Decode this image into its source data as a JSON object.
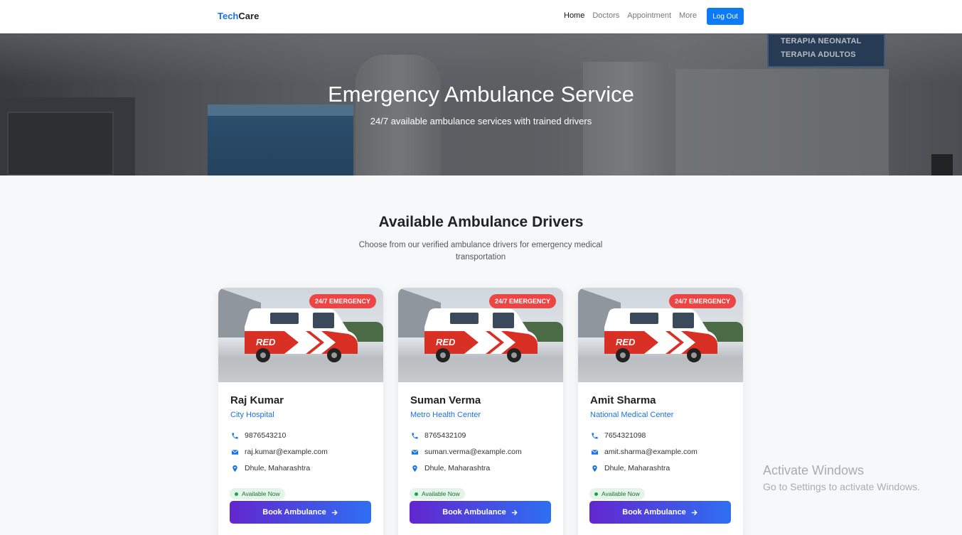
{
  "navbar": {
    "brand_part1": "Tech",
    "brand_part2": "Care",
    "links": [
      {
        "label": "Home",
        "active": true
      },
      {
        "label": "Doctors",
        "active": false
      },
      {
        "label": "Appointment",
        "active": false
      },
      {
        "label": "More",
        "active": false
      }
    ],
    "logout_label": "Log Out"
  },
  "hero": {
    "title": "Emergency Ambulance Service",
    "subtitle": "24/7 available ambulance services with trained drivers",
    "sign_lines": [
      "TERAPIA NEONATAL",
      "TERAPIA ADULTOS"
    ]
  },
  "section": {
    "title": "Available Ambulance Drivers",
    "subtitle": "Choose from our verified ambulance drivers for emergency medical transportation"
  },
  "drivers": [
    {
      "badge": "24/7 EMERGENCY",
      "name": "Raj Kumar",
      "hospital": "City Hospital",
      "phone": "9876543210",
      "email": "raj.kumar@example.com",
      "location": "Dhule, Maharashtra",
      "status": "Available Now",
      "button": "Book Ambulance"
    },
    {
      "badge": "24/7 EMERGENCY",
      "name": "Suman Verma",
      "hospital": "Metro Health Center",
      "phone": "8765432109",
      "email": "suman.verma@example.com",
      "location": "Dhule, Maharashtra",
      "status": "Available Now",
      "button": "Book Ambulance"
    },
    {
      "badge": "24/7 EMERGENCY",
      "name": "Amit Sharma",
      "hospital": "National Medical Center",
      "phone": "7654321098",
      "email": "amit.sharma@example.com",
      "location": "Dhule, Maharashtra",
      "status": "Available Now",
      "button": "Book Ambulance"
    }
  ],
  "van_text": "RED",
  "watermark": {
    "title": "Activate Windows",
    "subtitle": "Go to Settings to activate Windows."
  },
  "colors": {
    "accent": "#0d7bf3",
    "badge": "#ef4444",
    "button_start": "#6326cf",
    "button_end": "#2e6ff2"
  }
}
